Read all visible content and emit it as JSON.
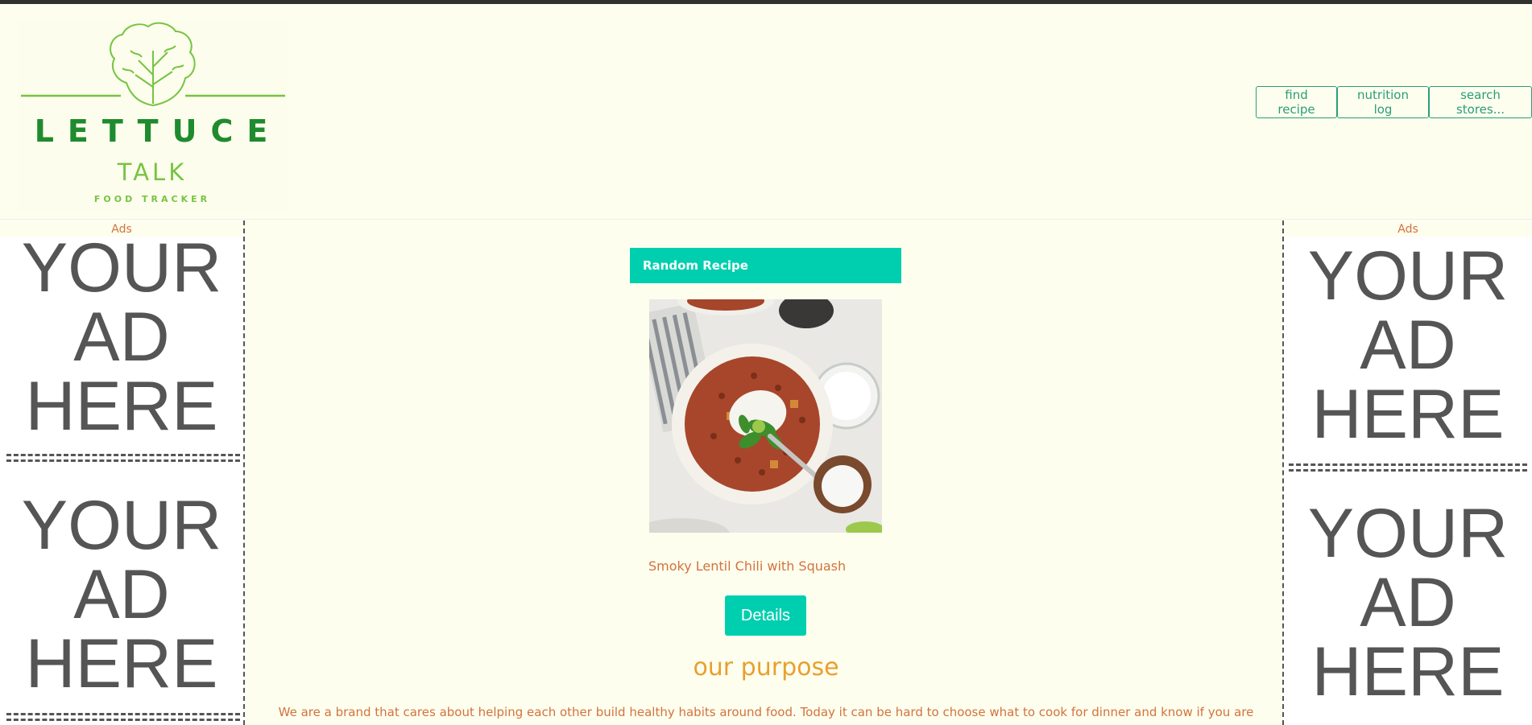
{
  "logo": {
    "word1": "LETTUCE",
    "word2": "TALK",
    "tagline": "FOOD TRACKER",
    "icon": "lettuce-icon",
    "colors": {
      "dark_green": "#1e8b2e",
      "light_green": "#76c442"
    }
  },
  "nav": {
    "items": [
      {
        "label": "find recipe"
      },
      {
        "label": "nutrition log"
      },
      {
        "label": "search stores..."
      }
    ],
    "color": "#2a9d7a"
  },
  "ads": {
    "left_label": "Ads",
    "right_label": "Ads",
    "placeholder_line1": "YOUR",
    "placeholder_line2": "AD",
    "placeholder_line3": "HERE"
  },
  "recipe": {
    "card_title": "Random Recipe",
    "name": "Smoky Lentil Chili with Squash",
    "details_label": "Details",
    "accent": "#00cfaf"
  },
  "purpose": {
    "title": "our purpose",
    "text": "We are a brand that cares about helping each other build healthy habits around food. Today it can be hard to choose what to cook for dinner and know if you are"
  }
}
